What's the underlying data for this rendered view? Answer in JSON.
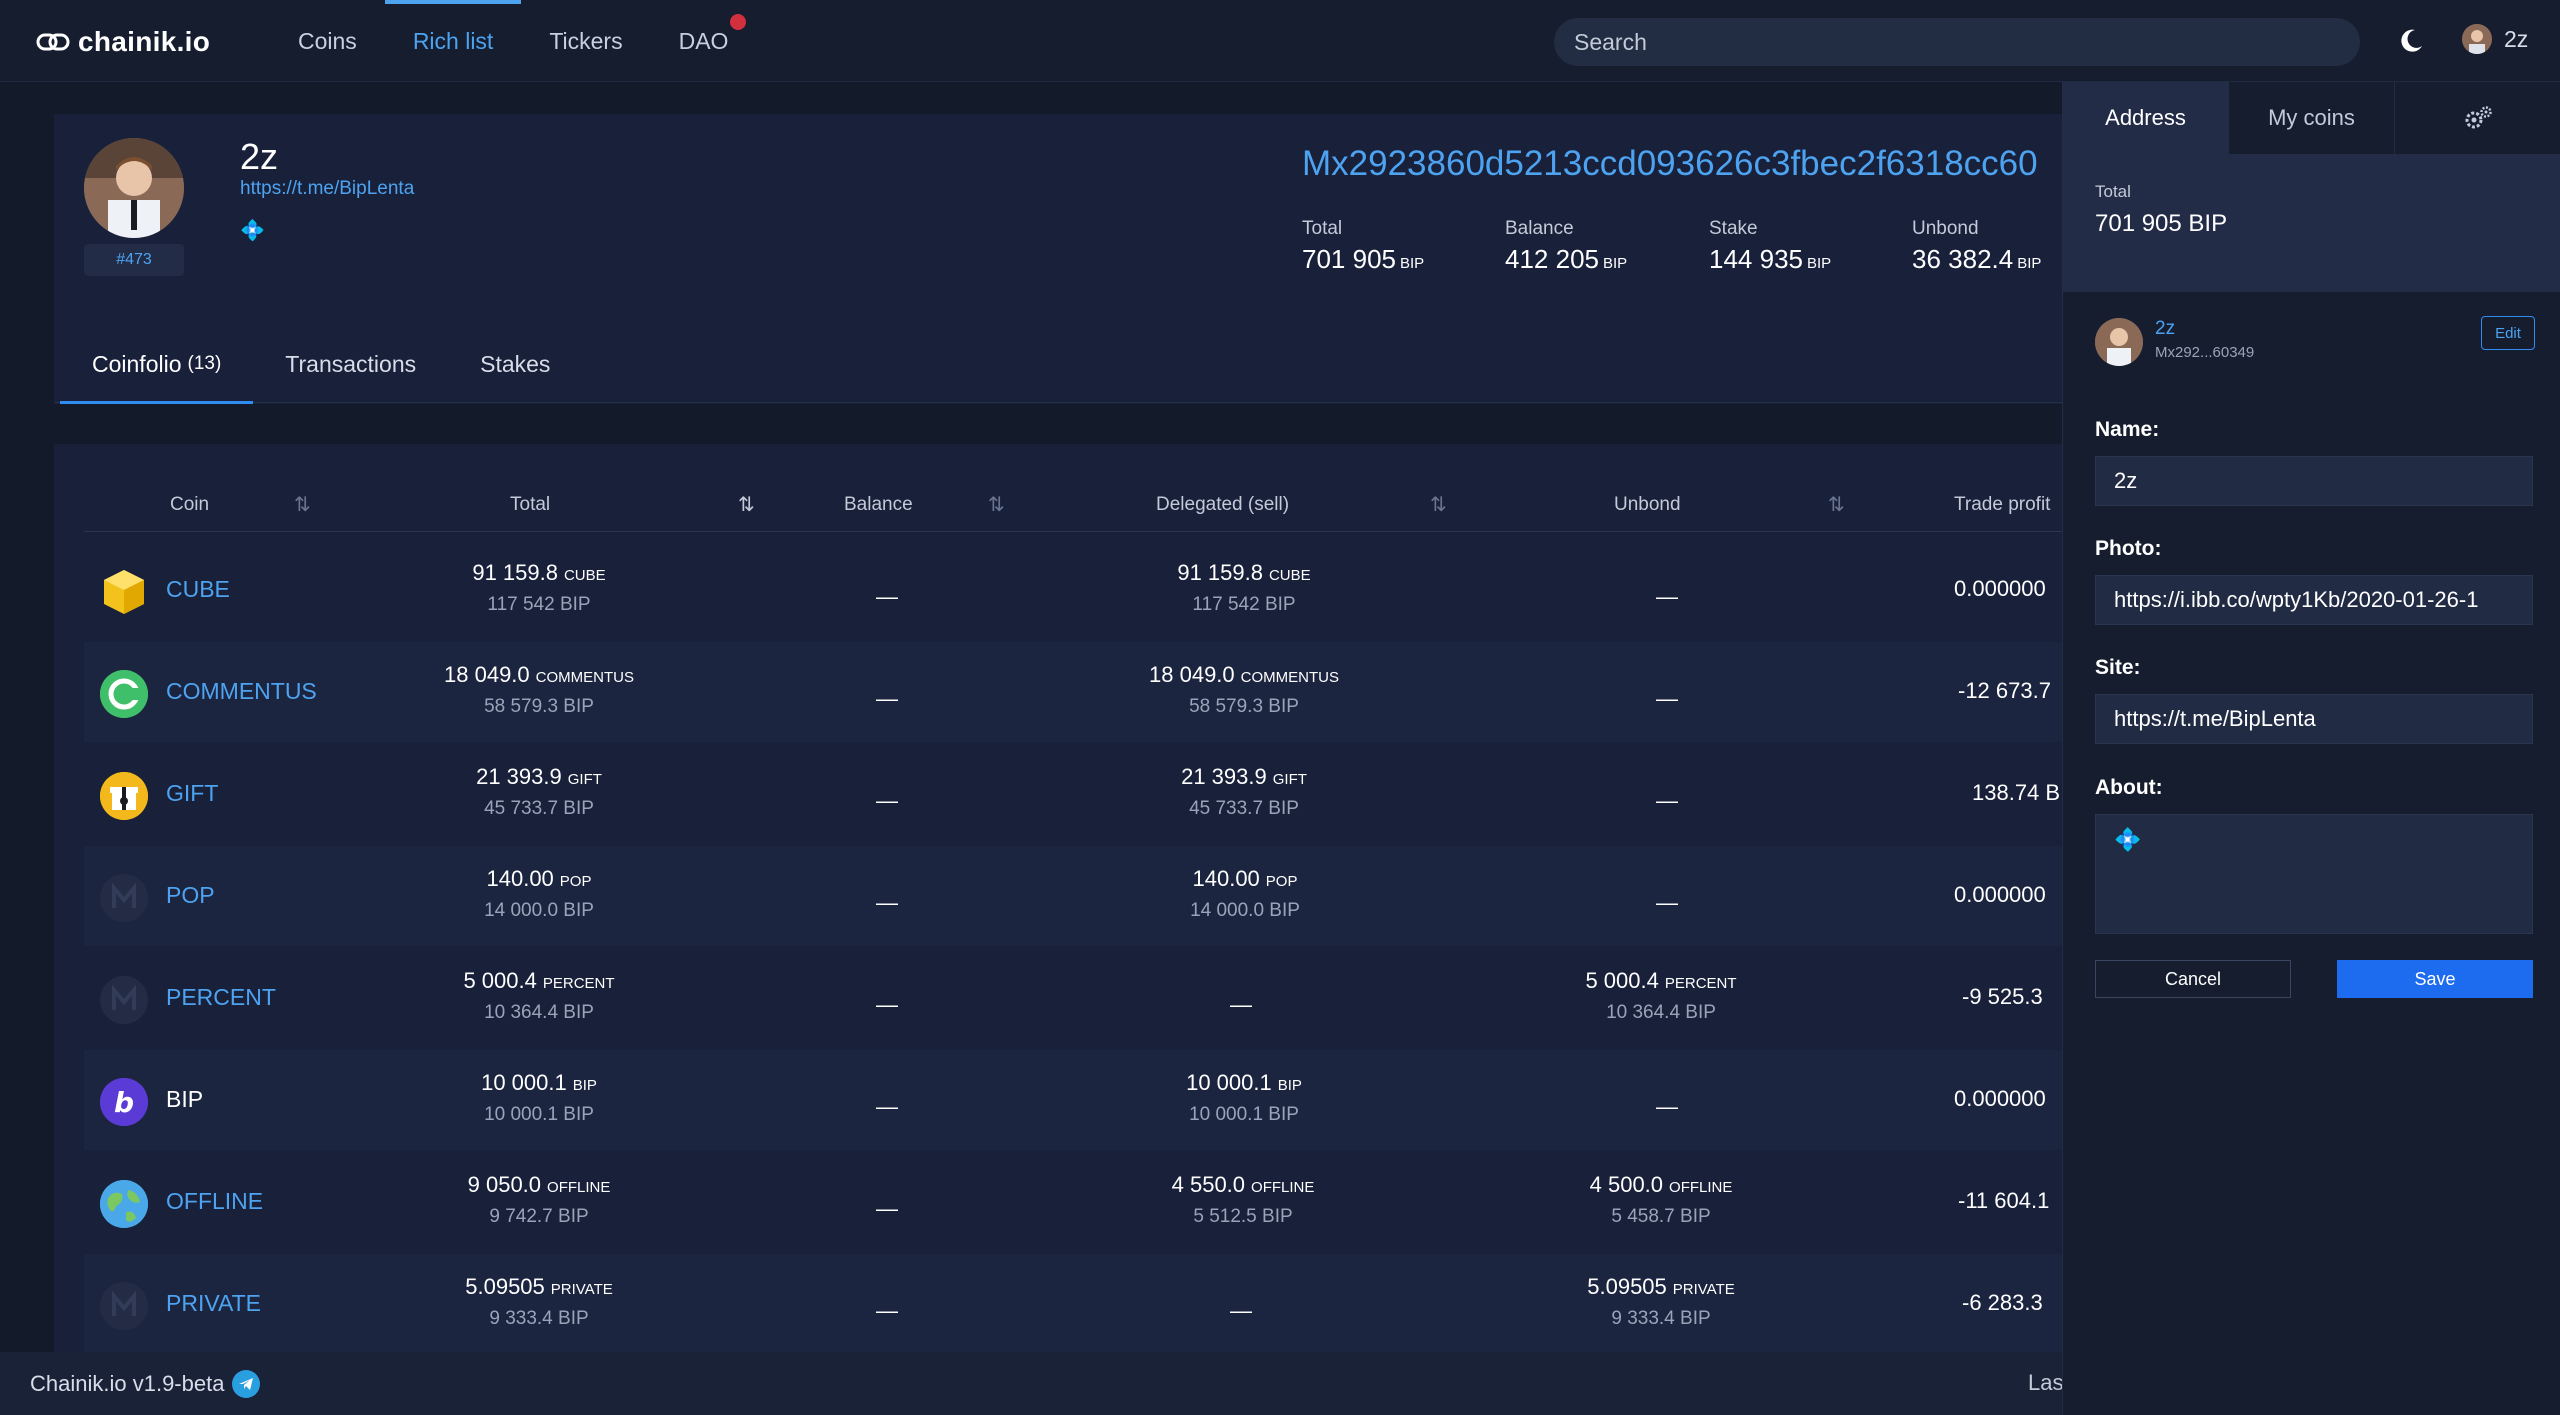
{
  "brand": {
    "name": "chainik.io"
  },
  "nav": {
    "items": [
      {
        "label": "Coins"
      },
      {
        "label": "Rich list"
      },
      {
        "label": "Tickers"
      },
      {
        "label": "DAO"
      }
    ],
    "active": "Rich list"
  },
  "search": {
    "placeholder": "Search"
  },
  "user": {
    "name": "2z"
  },
  "profile": {
    "name": "2z",
    "site": "https://t.me/BipLenta",
    "about": "💠",
    "rank": "#473",
    "address": "Mx2923860d5213ccd093626c3fbec2f6318cc60",
    "stats": [
      {
        "label": "Total",
        "value": "701 905",
        "unit": "BIP"
      },
      {
        "label": "Balance",
        "value": "412 205",
        "unit": "BIP"
      },
      {
        "label": "Stake",
        "value": "144 935",
        "unit": "BIP"
      },
      {
        "label": "Unbond",
        "value": "36 382.4",
        "unit": "BIP"
      }
    ]
  },
  "tabs": {
    "coinfolio": "Coinfolio",
    "coinfolio_count": "(13)",
    "transactions": "Transactions",
    "stakes": "Stakes"
  },
  "table": {
    "headers": {
      "coin": "Coin",
      "total": "Total",
      "balance": "Balance",
      "delegated": "Delegated (sell)",
      "unbond": "Unbond",
      "profit": "Trade profit"
    },
    "dash": "—",
    "rows": [
      {
        "coin": "CUBE",
        "icon": "cube-icon",
        "total": "91 159.8",
        "total_unit": "CUBE",
        "total_bip": "117 542 BIP",
        "delegated": "91 159.8",
        "delegated_unit": "CUBE",
        "delegated_bip": "117 542 BIP",
        "unbond": "",
        "unbond_unit": "",
        "unbond_bip": "",
        "profit": "0.000000"
      },
      {
        "coin": "COMMENTUS",
        "icon": "commentus-icon",
        "total": "18 049.0",
        "total_unit": "COMMENTUS",
        "total_bip": "58 579.3 BIP",
        "delegated": "18 049.0",
        "delegated_unit": "COMMENTUS",
        "delegated_bip": "58 579.3 BIP",
        "unbond": "",
        "unbond_unit": "",
        "unbond_bip": "",
        "profit": "-12 673.7"
      },
      {
        "coin": "GIFT",
        "icon": "gift-icon",
        "total": "21 393.9",
        "total_unit": "GIFT",
        "total_bip": "45 733.7 BIP",
        "delegated": "21 393.9",
        "delegated_unit": "GIFT",
        "delegated_bip": "45 733.7 BIP",
        "unbond": "",
        "unbond_unit": "",
        "unbond_bip": "",
        "profit": "138.74 B"
      },
      {
        "coin": "POP",
        "icon": "minter-icon",
        "total": "140.00",
        "total_unit": "POP",
        "total_bip": "14 000.0 BIP",
        "delegated": "140.00",
        "delegated_unit": "POP",
        "delegated_bip": "14 000.0 BIP",
        "unbond": "",
        "unbond_unit": "",
        "unbond_bip": "",
        "profit": "0.000000"
      },
      {
        "coin": "PERCENT",
        "icon": "minter-icon",
        "total": "5 000.4",
        "total_unit": "PERCENT",
        "total_bip": "10 364.4 BIP",
        "delegated": "",
        "delegated_unit": "",
        "delegated_bip": "",
        "unbond": "5 000.4",
        "unbond_unit": "PERCENT",
        "unbond_bip": "10 364.4 BIP",
        "profit": "-9 525.3"
      },
      {
        "coin": "BIP",
        "icon": "bip-icon",
        "total": "10 000.1",
        "total_unit": "BIP",
        "total_bip": "10 000.1 BIP",
        "delegated": "10 000.1",
        "delegated_unit": "BIP",
        "delegated_bip": "10 000.1 BIP",
        "unbond": "",
        "unbond_unit": "",
        "unbond_bip": "",
        "profit": "0.000000"
      },
      {
        "coin": "OFFLINE",
        "icon": "globe-icon",
        "total": "9 050.0",
        "total_unit": "OFFLINE",
        "total_bip": "9 742.7 BIP",
        "delegated": "4 550.0",
        "delegated_unit": "OFFLINE",
        "delegated_bip": "5 512.5 BIP",
        "unbond": "4 500.0",
        "unbond_unit": "OFFLINE",
        "unbond_bip": "5 458.7 BIP",
        "profit": "-11 604.1"
      },
      {
        "coin": "PRIVATE",
        "icon": "minter-icon",
        "total": "5.09505",
        "total_unit": "PRIVATE",
        "total_bip": "9 333.4 BIP",
        "delegated": "",
        "delegated_unit": "",
        "delegated_bip": "",
        "unbond": "5.09505",
        "unbond_unit": "PRIVATE",
        "unbond_bip": "9 333.4 BIP",
        "profit": "-6 283.3"
      }
    ]
  },
  "footer": {
    "version": "Chainik.io v1.9-beta",
    "right": "Las"
  },
  "panel": {
    "tabs": {
      "address": "Address",
      "my_coins": "My coins"
    },
    "total_label": "Total",
    "total_value": "701 905 BIP",
    "user_name": "2z",
    "user_addr": "Mx292...60349",
    "edit": "Edit",
    "labels": {
      "name": "Name:",
      "photo": "Photo:",
      "site": "Site:",
      "about": "About:"
    },
    "values": {
      "name": "2z",
      "photo": "https://i.ibb.co/wpty1Kb/2020-01-26-1",
      "site": "https://t.me/BipLenta",
      "about": "💠"
    },
    "cancel": "Cancel",
    "save": "Save"
  },
  "colors": {
    "accent": "#4da3f0",
    "primary_button": "#1d6cf0",
    "background": "#131a2a",
    "card": "#18203a",
    "notification_dot": "#d2303e"
  }
}
